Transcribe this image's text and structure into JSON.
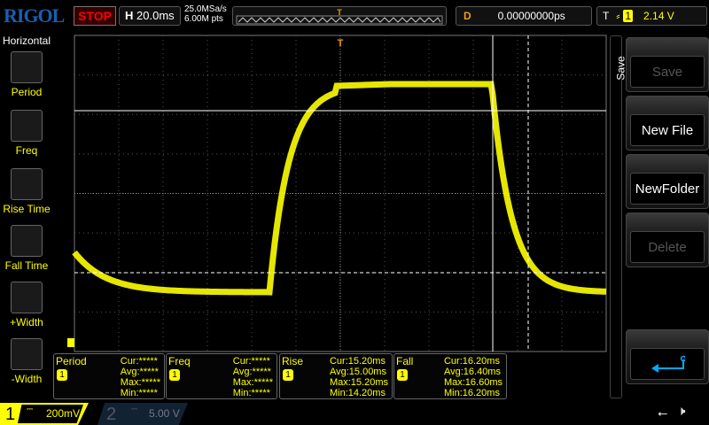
{
  "header": {
    "logo": "RIGOL",
    "run_state": "STOP",
    "h_label": "H",
    "timebase": "20.0ms",
    "sample_rate": "25.0MSa/s",
    "memory_depth": "6.00M pts",
    "delay_label": "D",
    "delay": "0.00000000ps",
    "trigger_label": "T",
    "trigger_source": "1",
    "trigger_level": "2.14 V",
    "trigger_edge": "rising"
  },
  "sidebar": {
    "title": "Horizontal",
    "items": [
      {
        "label": "Period",
        "icon": "period-icon"
      },
      {
        "label": "Freq",
        "icon": "freq-icon"
      },
      {
        "label": "Rise Time",
        "icon": "rise-time-icon"
      },
      {
        "label": "Fall Time",
        "icon": "fall-time-icon"
      },
      {
        "label": "+Width",
        "icon": "plus-width-icon"
      },
      {
        "label": "-Width",
        "icon": "minus-width-icon"
      }
    ]
  },
  "menu": {
    "title": "Save",
    "buttons": [
      {
        "label": "Save",
        "enabled": false
      },
      {
        "label": "New File",
        "enabled": true
      },
      {
        "label": "NewFolder",
        "enabled": true
      },
      {
        "label": "Delete",
        "enabled": false
      },
      {
        "label": "",
        "icon": "return-icon",
        "enabled": true
      }
    ]
  },
  "measurements": [
    {
      "name": "Period",
      "source": "1",
      "cur": "Cur:*****",
      "avg": "Avg:*****",
      "max": "Max:*****",
      "min": "Min:*****"
    },
    {
      "name": "Freq",
      "source": "1",
      "cur": "Cur:*****",
      "avg": "Avg:*****",
      "max": "Max:*****",
      "min": "Min:*****"
    },
    {
      "name": "Rise",
      "source": "1",
      "cur": "Cur:15.20ms",
      "avg": "Avg:15.00ms",
      "max": "Max:15.20ms",
      "min": "Min:14.20ms"
    },
    {
      "name": "Fall",
      "source": "1",
      "cur": "Cur:16.20ms",
      "avg": "Avg:16.40ms",
      "max": "Max:16.60ms",
      "min": "Min:16.20ms"
    }
  ],
  "channels": [
    {
      "num": "1",
      "coupling": "DC",
      "scale": "200mV",
      "active": true
    },
    {
      "num": "2",
      "coupling": "DC",
      "scale": "5.00 V",
      "active": false
    }
  ],
  "colors": {
    "ch1": "#ffff00",
    "trigger": "#f39c12",
    "accent": "#00aaff"
  },
  "status_icons": [
    "usb-icon",
    "mute-icon"
  ]
}
